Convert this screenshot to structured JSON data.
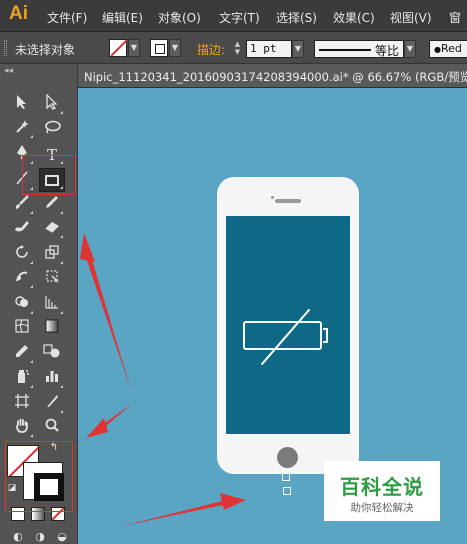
{
  "app": {
    "logo": "Ai"
  },
  "menu": [
    "文件(F)",
    "编辑(E)",
    "对象(O)",
    "文字(T)",
    "选择(S)",
    "效果(C)",
    "视图(V)",
    "窗"
  ],
  "control_bar": {
    "selection_status": "未选择对象",
    "stroke_label": "描边:",
    "stroke_weight": "1 pt",
    "stroke_profile": "等比",
    "brush_preset": "Red"
  },
  "document": {
    "tab_title": "Nipic_11120341_20160903174208394000.ai* @ 66.67% (RGB/预览"
  },
  "toolbox": {
    "collapse": "◂◂",
    "tools": [
      "selection-tool",
      "direct-selection-tool",
      "magic-wand-tool",
      "lasso-tool",
      "pen-tool",
      "type-tool",
      "line-segment-tool",
      "rectangle-tool",
      "paintbrush-tool",
      "pencil-tool",
      "blob-brush-tool",
      "eraser-tool",
      "rotate-tool",
      "scale-tool",
      "warp-tool",
      "free-transform-tool",
      "shape-builder-tool",
      "perspective-grid-tool",
      "mesh-tool",
      "gradient-tool",
      "eyedropper-tool",
      "blend-tool",
      "symbol-sprayer-tool",
      "column-graph-tool",
      "artboard-tool",
      "slice-tool",
      "hand-tool",
      "zoom-tool"
    ],
    "active_tool": "rectangle-tool"
  },
  "canvas": {
    "background_color": "#5aa5c3",
    "screen_color": "#0e6986"
  },
  "watermark": {
    "title": "百科全说",
    "subtitle": "助你轻松解决"
  },
  "colors": {
    "annotation_red": "#e03333",
    "brand_orange": "#f0a21c",
    "watermark_green": "#2e9c41"
  }
}
